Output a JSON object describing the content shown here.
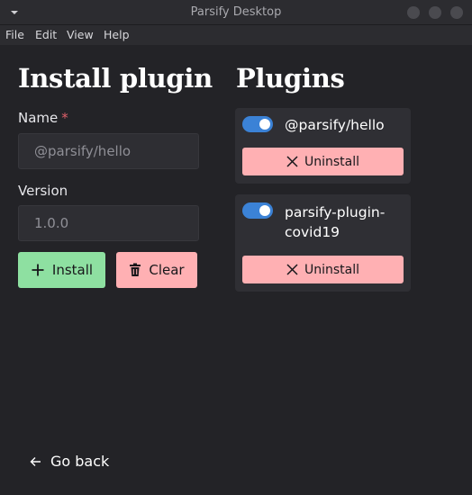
{
  "window": {
    "title": "Parsify Desktop"
  },
  "menubar": {
    "items": [
      "File",
      "Edit",
      "View",
      "Help"
    ]
  },
  "install": {
    "heading": "Install plugin",
    "name_label": "Name",
    "required_mark": "*",
    "name_placeholder": "@parsify/hello",
    "version_label": "Version",
    "version_placeholder": "1.0.0",
    "install_label": "Install",
    "clear_label": "Clear"
  },
  "plugins": {
    "heading": "Plugins",
    "items": [
      {
        "name": "@parsify/hello",
        "enabled": true,
        "uninstall_label": "Uninstall"
      },
      {
        "name": "parsify-plugin-covid19",
        "enabled": true,
        "uninstall_label": "Uninstall"
      }
    ]
  },
  "footer": {
    "back_label": "Go back"
  },
  "colors": {
    "background": "#232327",
    "install_button": "#8ee0a1",
    "danger_button": "#ffb0b3",
    "toggle_on": "#3b82d6",
    "required": "#e0606a"
  },
  "icons": {
    "window_menu": "chevron-down-icon",
    "install": "plus-icon",
    "clear": "trash-icon",
    "uninstall": "close-icon",
    "back": "arrow-left-icon"
  }
}
